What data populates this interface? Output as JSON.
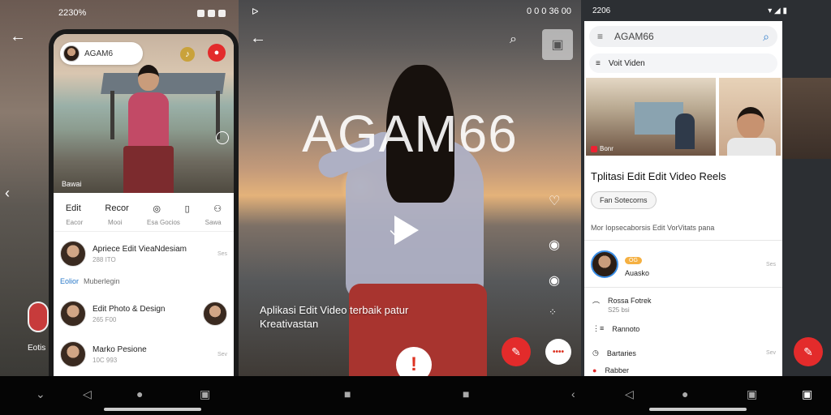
{
  "left": {
    "status_time": "2230%",
    "user_pill_name": "AGAM6",
    "photo_caption": "Bawai",
    "tabs": [
      "Edit",
      "Recor"
    ],
    "tab_subs": [
      "Eacor",
      "Mooi",
      "Esa Gocios",
      "Sawa"
    ],
    "list": [
      {
        "title": "Apriece Edit VieaNdesiam",
        "sub": "288 ITO",
        "right": "Ses"
      },
      {
        "title": "Edit Photo & Design",
        "sub": "265 F00",
        "right": ""
      },
      {
        "title": "Marko Pesione",
        "sub": "10C 993",
        "right": "Sev"
      }
    ],
    "section_label": "Eolior",
    "section_label_sub": "Muberlegin",
    "side_label": "Eotis"
  },
  "middle": {
    "title": "AGAM66",
    "caption": "Aplikasi Edit Video terbaik patur Kreativastan",
    "status_left": "ᐅ",
    "status_right": "0 0 0 36 00",
    "alert_symbol": "!",
    "fab_dots": "••••"
  },
  "right": {
    "status_time": "2206",
    "search_value": "AGAM66",
    "menu_label": "Voit Viden",
    "thumb1_caption": "Bonr",
    "heading": "Tplitasi Edit Edit Video Reels",
    "chip": "Fan Sotecorns",
    "desc": "Mor Iopsecaborsis Edit VorVitats pana",
    "user": {
      "badge": "OG",
      "name": "Auasko",
      "dots": "Ses"
    },
    "rows": [
      {
        "title": "Rossa Fotrek",
        "sub": "S25 bsi",
        "dots": ""
      },
      {
        "title": "Rannoto",
        "sub": "",
        "dots": ""
      },
      {
        "title": "Bartaries",
        "sub": "",
        "dots": "Sev"
      },
      {
        "title": "Rabber",
        "sub": "",
        "dots": ""
      }
    ]
  },
  "colors": {
    "accent_red": "#e32b2b",
    "accent_blue": "#2979c9"
  }
}
